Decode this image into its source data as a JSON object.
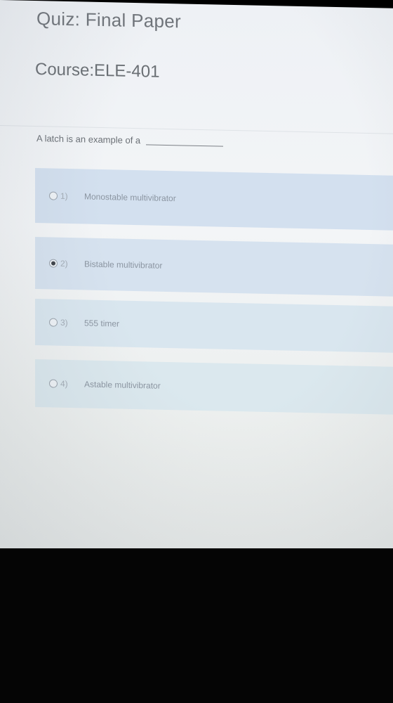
{
  "header": {
    "title": "Quiz: Final Paper",
    "course": "Course:ELE-401"
  },
  "question": {
    "text": "A latch is an example of a"
  },
  "options": [
    {
      "number": "1)",
      "label": "Monostable multivibrator",
      "selected": false
    },
    {
      "number": "2)",
      "label": "Bistable multivibrator",
      "selected": true
    },
    {
      "number": "3)",
      "label": "555 timer",
      "selected": false
    },
    {
      "number": "4)",
      "label": "Astable multivibrator",
      "selected": false
    }
  ],
  "colors": {
    "option_bg": "#d3e0ef",
    "text": "#6f747a"
  }
}
